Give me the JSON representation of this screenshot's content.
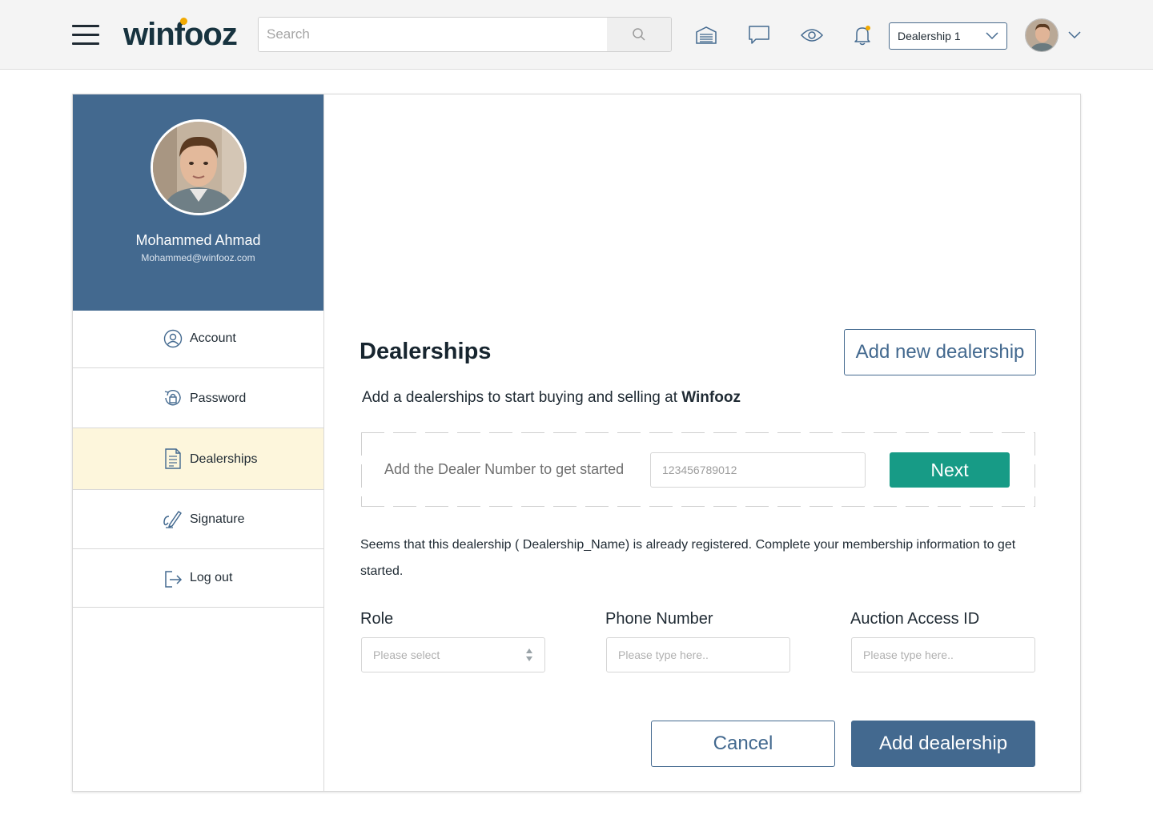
{
  "header": {
    "logo_text": "winfooz",
    "search_placeholder": "Search",
    "dealership_selected": "Dealership 1",
    "icons": [
      "menu-icon",
      "search-icon",
      "garage-icon",
      "chat-icon",
      "eye-icon",
      "bell-icon",
      "chevron-down-icon"
    ]
  },
  "profile": {
    "name": "Mohammed Ahmad",
    "email": "Mohammed@winfooz.com"
  },
  "nav": [
    {
      "label": "Account",
      "icon": "user-circle-icon",
      "active": false
    },
    {
      "label": "Password",
      "icon": "lock-icon",
      "active": false
    },
    {
      "label": "Dealerships",
      "icon": "document-icon",
      "active": true
    },
    {
      "label": "Signature",
      "icon": "signature-icon",
      "active": false
    },
    {
      "label": "Log out",
      "icon": "logout-icon",
      "active": false
    }
  ],
  "main": {
    "title": "Dealerships",
    "add_new_label": "Add new dealership",
    "subtitle_prefix": "Add a dealerships to start buying and selling at ",
    "subtitle_brand": "Winfooz",
    "dealer_prompt": "Add the Dealer Number to get started",
    "dealer_number_placeholder": "123456789012",
    "next_label": "Next",
    "notice": "Seems that this dealership ( Dealership_Name) is already registered. Complete your membership information to get started.",
    "fields": {
      "role_label": "Role",
      "role_placeholder": "Please select",
      "phone_label": "Phone Number",
      "phone_placeholder": "Please type here..",
      "auction_label": "Auction Access ID",
      "auction_placeholder": "Please type here.."
    },
    "cancel_label": "Cancel",
    "add_label": "Add dealership"
  },
  "colors": {
    "primary": "#43698f",
    "accent_green": "#179b86",
    "logo_dot": "#f2a900",
    "active_nav_bg": "#fdf6dc"
  }
}
